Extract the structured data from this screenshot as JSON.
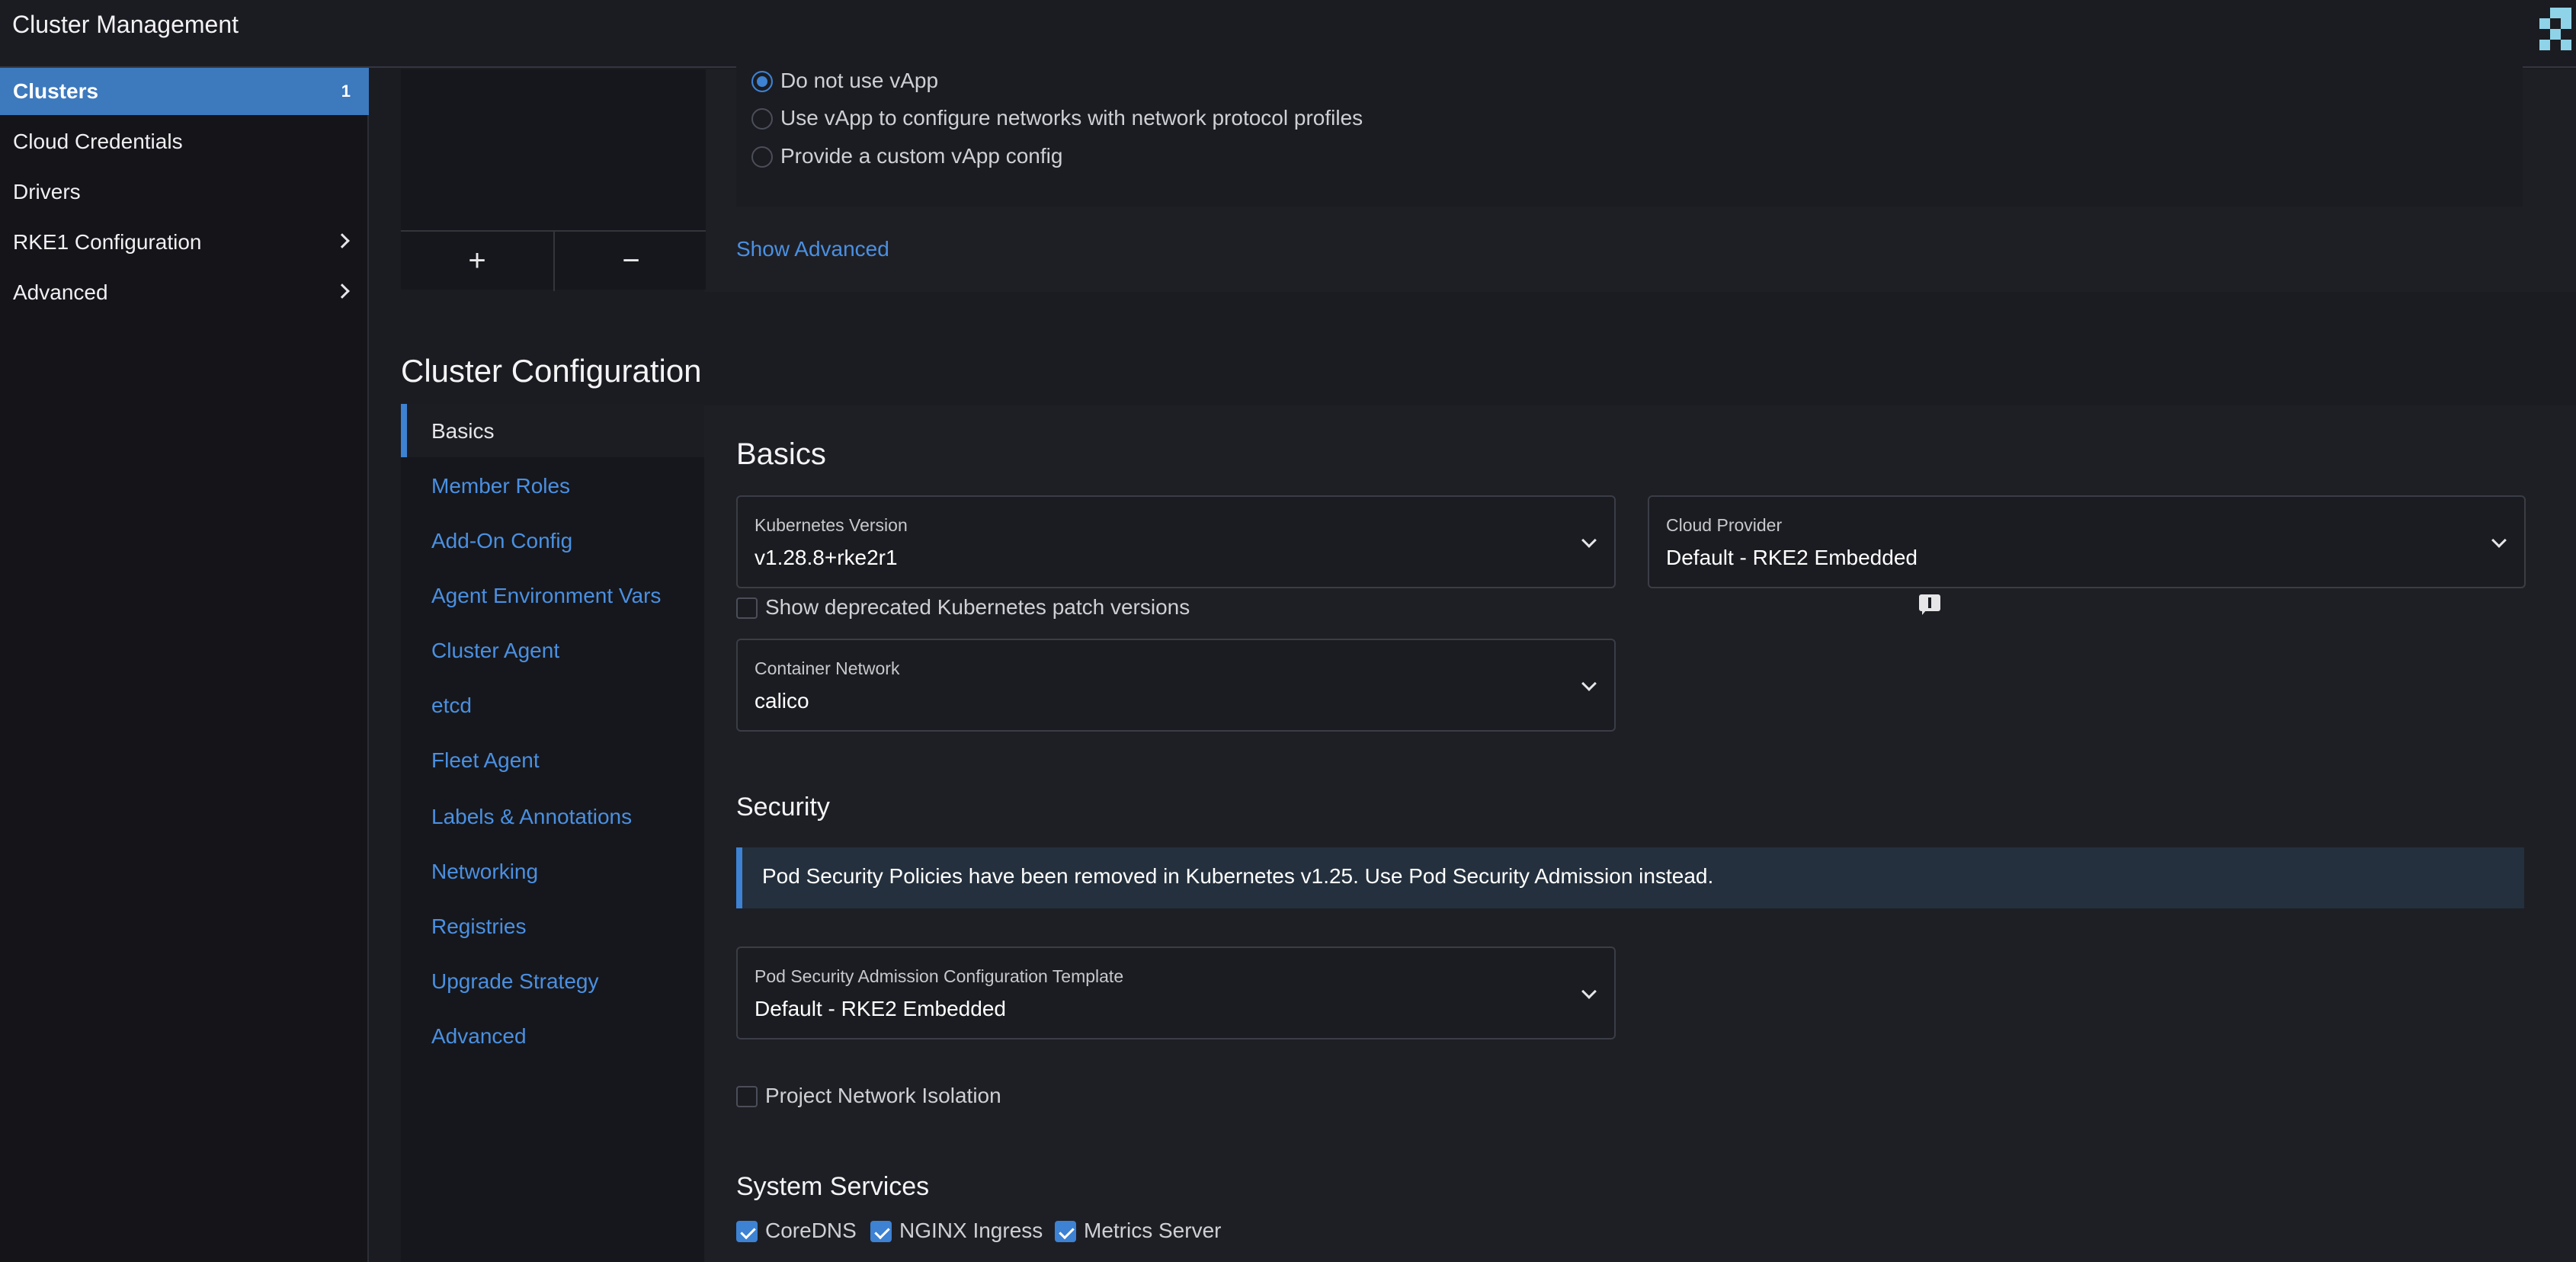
{
  "header": {
    "title": "Cluster Management"
  },
  "sidebar": {
    "items": [
      {
        "label": "Clusters",
        "count": "1",
        "active": true
      },
      {
        "label": "Cloud Credentials"
      },
      {
        "label": "Drivers"
      },
      {
        "label": "RKE1 Configuration",
        "expandable": true
      },
      {
        "label": "Advanced",
        "expandable": true
      }
    ]
  },
  "vapp": {
    "options": [
      {
        "label": "Do not use vApp",
        "selected": true
      },
      {
        "label": "Use vApp to configure networks with network protocol profiles",
        "selected": false
      },
      {
        "label": "Provide a custom vApp config",
        "selected": false
      }
    ],
    "show_advanced": "Show Advanced",
    "add_label": "+",
    "remove_label": "−"
  },
  "cluster_config": {
    "title": "Cluster Configuration",
    "tabs": [
      "Basics",
      "Member Roles",
      "Add-On Config",
      "Agent Environment Vars",
      "Cluster Agent",
      "etcd",
      "Fleet Agent",
      "Labels & Annotations",
      "Networking",
      "Registries",
      "Upgrade Strategy",
      "Advanced"
    ],
    "active_tab": "Basics"
  },
  "basics": {
    "title": "Basics",
    "k8s_version": {
      "label": "Kubernetes Version",
      "value": "v1.28.8+rke2r1"
    },
    "cloud_provider": {
      "label": "Cloud Provider",
      "value": "Default - RKE2 Embedded"
    },
    "show_deprecated": {
      "label": "Show deprecated Kubernetes patch versions",
      "checked": false
    },
    "container_network": {
      "label": "Container Network",
      "value": "calico"
    }
  },
  "security": {
    "title": "Security",
    "banner": "Pod Security Policies have been removed in Kubernetes v1.25. Use Pod Security Admission instead.",
    "psa_template": {
      "label": "Pod Security Admission Configuration Template",
      "value": "Default - RKE2 Embedded"
    },
    "project_isolation": {
      "label": "Project Network Isolation",
      "checked": false
    }
  },
  "system_services": {
    "title": "System Services",
    "items": [
      {
        "label": "CoreDNS",
        "checked": true
      },
      {
        "label": "NGINX Ingress",
        "checked": true
      },
      {
        "label": "Metrics Server",
        "checked": true
      }
    ]
  },
  "colors": {
    "accent": "#3d82d3",
    "link": "#4a90e2",
    "nav_active": "#3d79bd"
  }
}
